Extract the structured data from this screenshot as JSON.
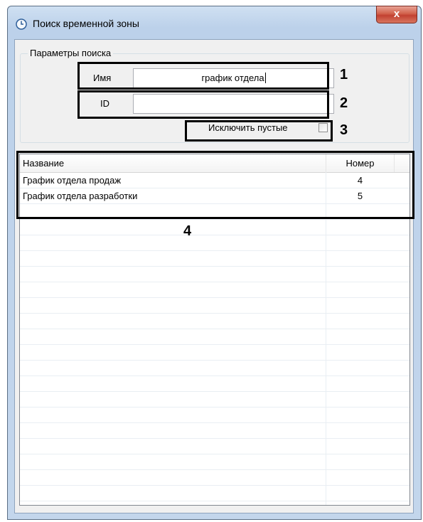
{
  "window": {
    "title": "Поиск временной зоны",
    "close_label": "x",
    "icon": "clock-icon"
  },
  "search": {
    "group_label": "Параметры поиска",
    "name_label": "Имя",
    "name_value": "график отдела",
    "id_label": "ID",
    "id_value": "",
    "exclude_empty_label": "Исключить пустые",
    "exclude_empty_checked": false
  },
  "results": {
    "columns": [
      "Название",
      "Номер"
    ],
    "rows": [
      {
        "name": "График отдела продаж",
        "number": "4"
      },
      {
        "name": "График отдела разработки",
        "number": "5"
      }
    ]
  },
  "annotations": [
    "1",
    "2",
    "3",
    "4"
  ]
}
